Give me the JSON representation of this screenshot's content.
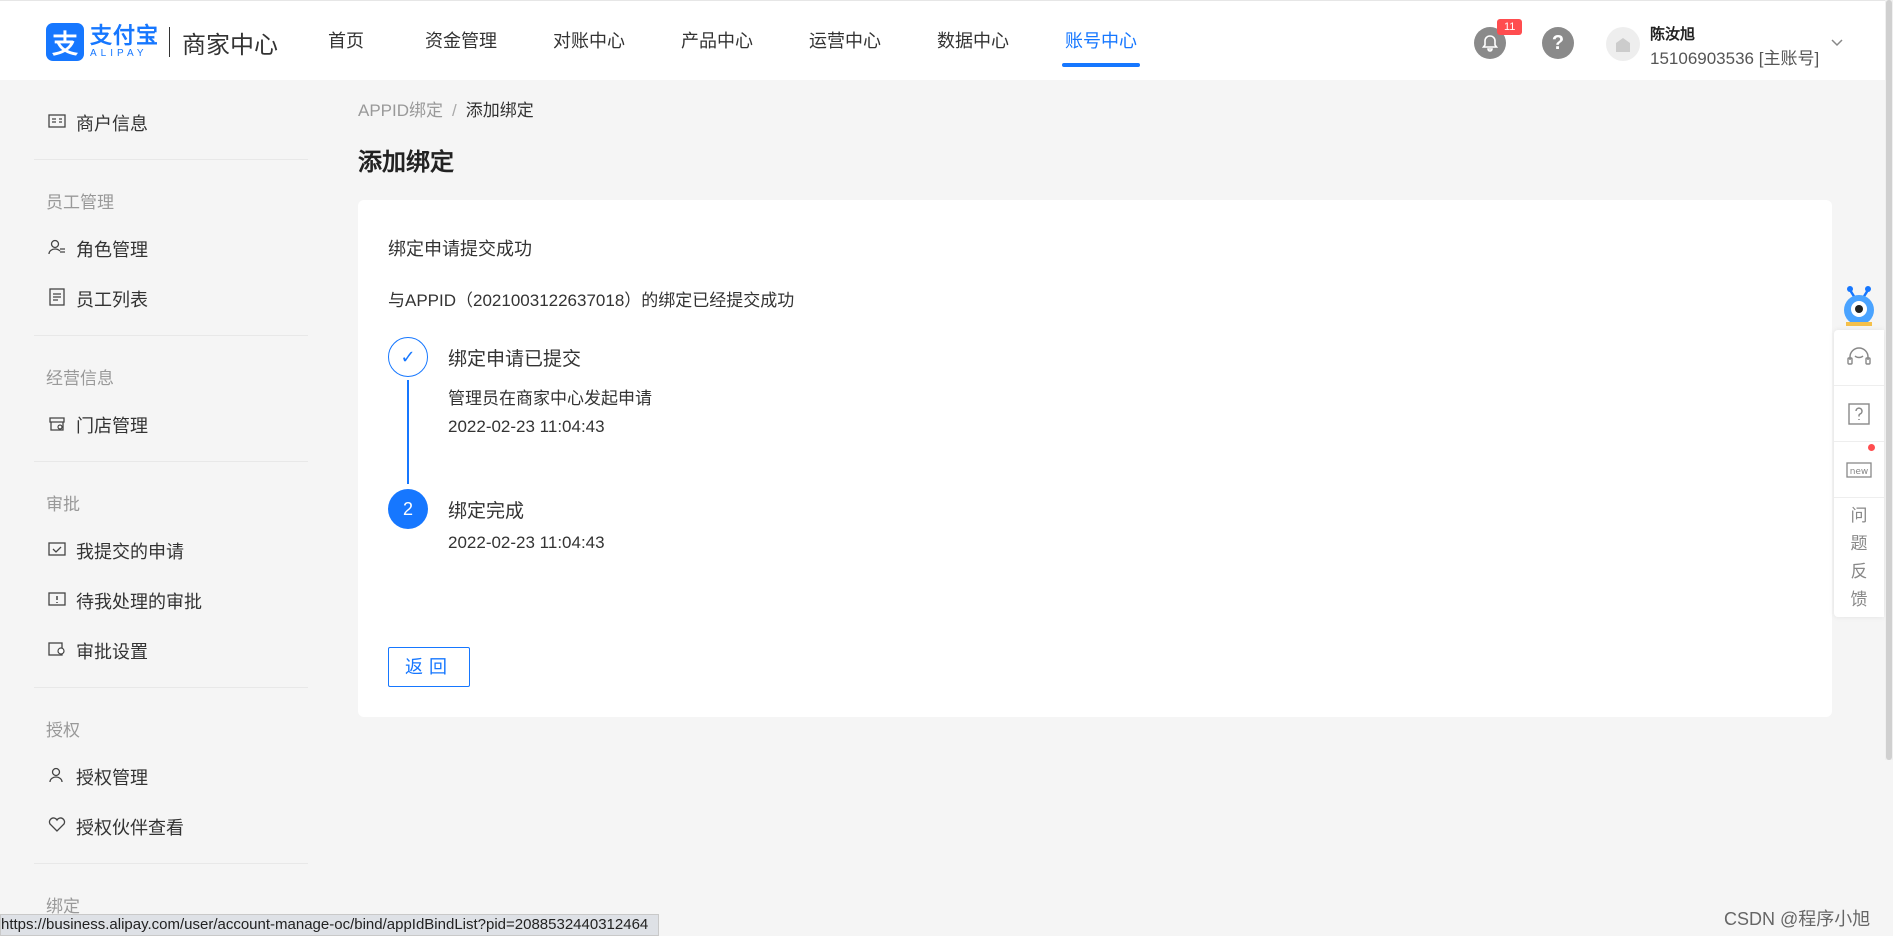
{
  "header": {
    "logo_cn": "支付宝",
    "logo_en": "ALIPAY",
    "logo_mark": "支",
    "portal_title": "商家中心",
    "nav": [
      {
        "label": "首页",
        "active": false
      },
      {
        "label": "资金管理",
        "active": false
      },
      {
        "label": "对账中心",
        "active": false
      },
      {
        "label": "产品中心",
        "active": false
      },
      {
        "label": "运营中心",
        "active": false
      },
      {
        "label": "数据中心",
        "active": false
      },
      {
        "label": "账号中心",
        "active": true
      }
    ],
    "notification_count": "11",
    "help_glyph": "?",
    "user_name": "陈汝旭",
    "user_account": "15106903536 [主账号]",
    "icons": {
      "bell": "bell-icon",
      "help": "help-icon",
      "avatar": "avatar-icon",
      "caret": "chevron-down-icon"
    }
  },
  "sidebar": {
    "merchant_info": "商户信息",
    "groups": {
      "staff": "员工管理",
      "business": "经营信息",
      "approval": "审批",
      "auth": "授权",
      "bind": "绑定"
    },
    "items": {
      "role": "角色管理",
      "staff_list": "员工列表",
      "store": "门店管理",
      "my_apply": "我提交的申请",
      "pending": "待我处理的审批",
      "approval_settings": "审批设置",
      "auth_manage": "授权管理",
      "partner_view": "授权伙伴查看"
    }
  },
  "main": {
    "breadcrumb": {
      "parent": "APPID绑定",
      "separator": "/",
      "current": "添加绑定"
    },
    "title": "添加绑定",
    "result_title": "绑定申请提交成功",
    "result_desc": "与APPID（2021003122637018）的绑定已经提交成功",
    "steps": [
      {
        "marker": "✓",
        "title": "绑定申请已提交",
        "desc": "管理员在商家中心发起申请",
        "time": "2022-02-23 11:04:43"
      },
      {
        "marker": "2",
        "title": "绑定完成",
        "time": "2022-02-23 11:04:43"
      }
    ],
    "back_button": "返回"
  },
  "float_bar": {
    "feedback": [
      "问",
      "题",
      "反",
      "馈"
    ],
    "icons": [
      "customer-service-icon",
      "help-icon",
      "new-icon"
    ],
    "new_label": "new"
  },
  "status_url": "https://business.alipay.com/user/account-manage-oc/bind/appIdBindList?pid=2088532440312464",
  "watermark": "CSDN @程序小旭",
  "colors": {
    "accent": "#1677ff",
    "badge": "#ff4d4f"
  }
}
